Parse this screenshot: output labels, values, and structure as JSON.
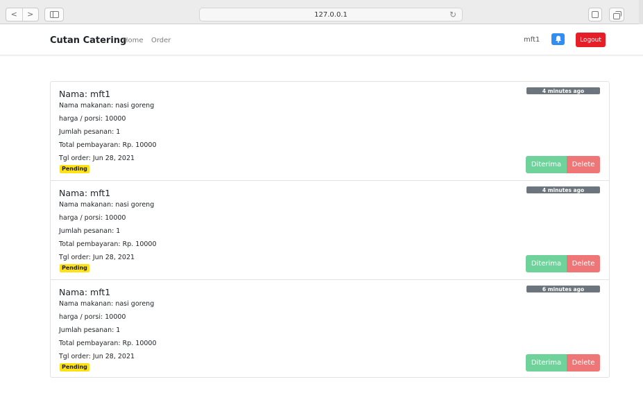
{
  "browser": {
    "url": "127.0.0.1",
    "back_glyph": "<",
    "forward_glyph": ">"
  },
  "navbar": {
    "brand": "Cutan Catering",
    "links": [
      "Home",
      "Order"
    ],
    "username": "mft1",
    "logout_label": "Logout",
    "bell_color": "#2f8df3",
    "logout_color": "#e61e28"
  },
  "orders": [
    {
      "name": "Nama: mft1",
      "food": "Nama makanan: nasi goreng",
      "price": "harga / porsi: 10000",
      "quantity": "Jumlah pesanan: 1",
      "total": "Total pembayaran: Rp. 10000",
      "date": "Tgl order: Jun 28, 2021",
      "status": "Pending",
      "time_ago": "4 minutes ago",
      "accept_label": "Diterima",
      "delete_label": "Delete"
    },
    {
      "name": "Nama: mft1",
      "food": "Nama makanan: nasi goreng",
      "price": "harga / porsi: 10000",
      "quantity": "Jumlah pesanan: 1",
      "total": "Total pembayaran: Rp. 10000",
      "date": "Tgl order: Jun 28, 2021",
      "status": "Pending",
      "time_ago": "4 minutes ago",
      "accept_label": "Diterima",
      "delete_label": "Delete"
    },
    {
      "name": "Nama: mft1",
      "food": "Nama makanan: nasi goreng",
      "price": "harga / porsi: 10000",
      "quantity": "Jumlah pesanan: 1",
      "total": "Total pembayaran: Rp. 10000",
      "date": "Tgl order: Jun 28, 2021",
      "status": "Pending",
      "time_ago": "6 minutes ago",
      "accept_label": "Diterima",
      "delete_label": "Delete"
    }
  ],
  "colors": {
    "status_pending": "#ffe11a",
    "time_badge": "#6c757d",
    "accept": "#6fd29a",
    "delete": "#ef7677"
  }
}
